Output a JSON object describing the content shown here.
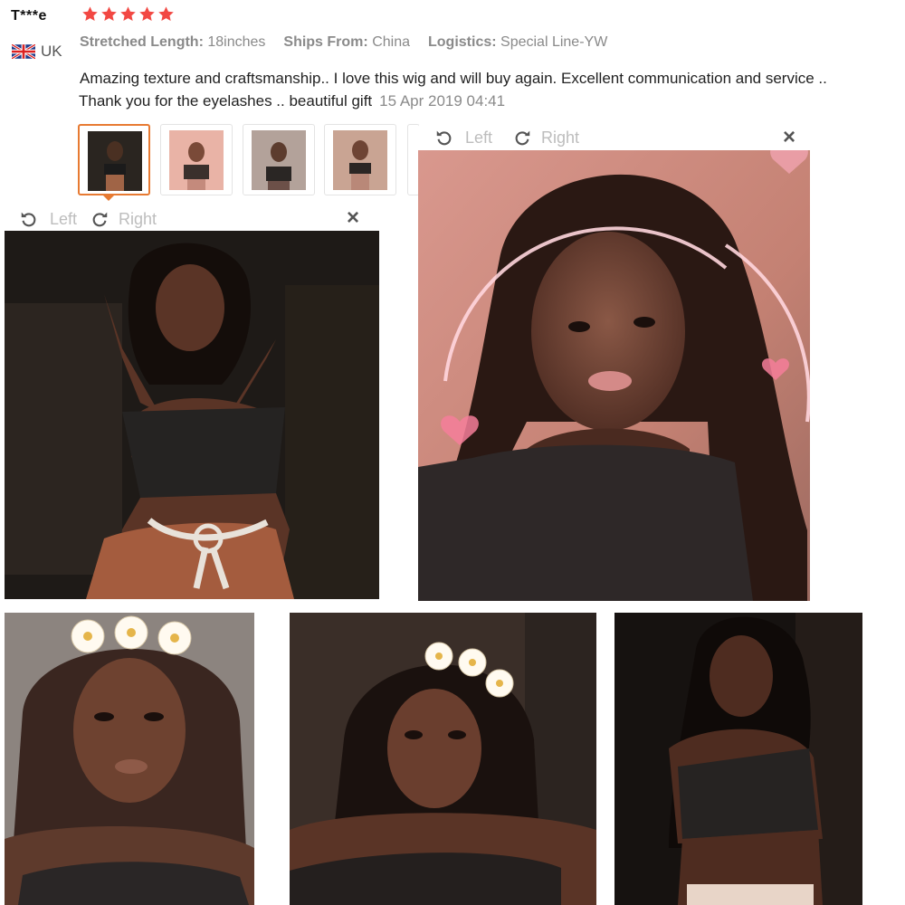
{
  "review": {
    "reviewer": "T***e",
    "rating": 5,
    "country": "UK",
    "specs": [
      {
        "key": "Stretched Length:",
        "value": "18inches"
      },
      {
        "key": "Ships From:",
        "value": "China"
      },
      {
        "key": "Logistics:",
        "value": "Special Line-YW"
      }
    ],
    "text_line1": "Amazing texture and craftsmanship.. I love this wig and will buy again. Excellent communication and service ..",
    "text_line2": "Thank  you for the eyelashes .. beautiful gift",
    "date": "15 Apr 2019 04:41"
  },
  "viewer": {
    "rotate_left": "Left",
    "rotate_right": "Right",
    "close": "×"
  },
  "colors": {
    "star": "#f24843",
    "active_thumb": "#e77a32"
  }
}
